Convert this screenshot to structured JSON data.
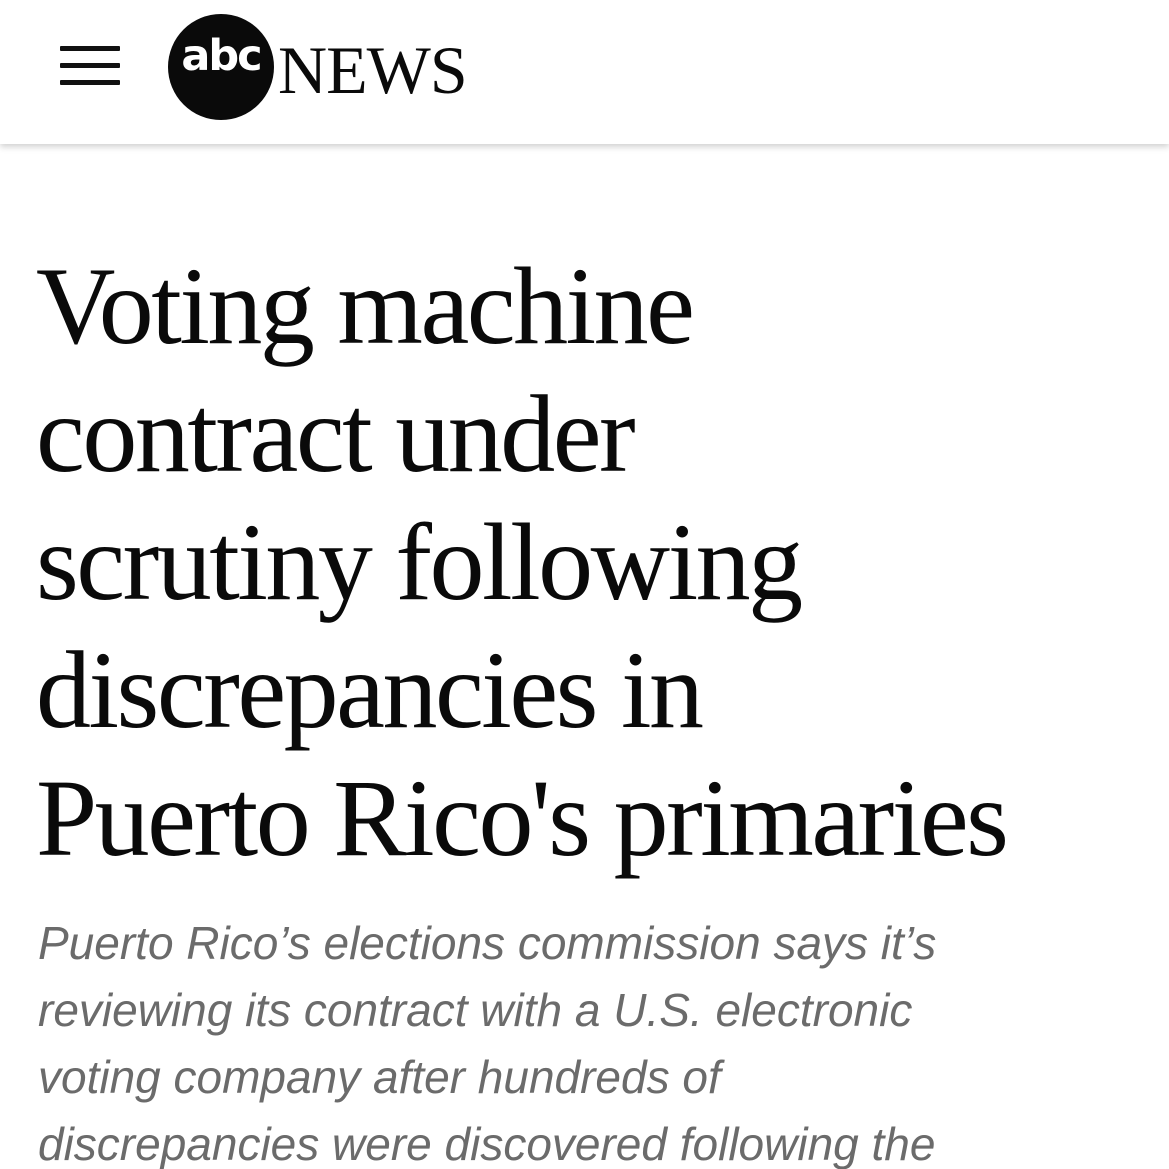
{
  "header": {
    "menu_icon": "hamburger-menu-icon",
    "logo": {
      "mark_text": "abc",
      "word_text": "NEWS"
    }
  },
  "article": {
    "headline_lines": [
      "Voting machine",
      "contract under",
      "scrutiny following",
      "discrepancies in",
      "Puerto Rico's primaries"
    ],
    "summary_lines": [
      "Puerto Rico’s elections commission says it’s",
      "reviewing its contract with a U.S. electronic",
      "voting company after hundreds of",
      "discrepancies were discovered following the"
    ]
  },
  "colors": {
    "text": "#0a0a0a",
    "summary_text": "#6b6b6b",
    "background": "#ffffff"
  }
}
